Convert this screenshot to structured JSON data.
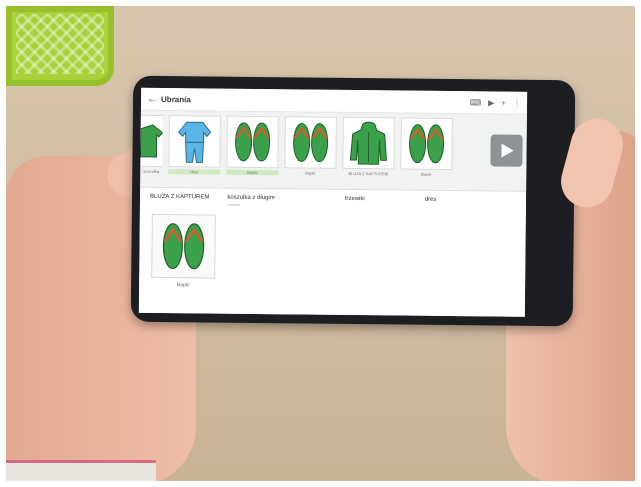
{
  "app": {
    "title": "Ubrania",
    "toolbar_icons": [
      "keyboard-icon",
      "play-icon",
      "plus-icon",
      "more-icon"
    ]
  },
  "strip": {
    "tiles": [
      {
        "label": "koszulka",
        "icon": "shirt-icon",
        "partial": true
      },
      {
        "label": "dres",
        "icon": "tracksuit-icon",
        "selected": true
      },
      {
        "label": "klapki",
        "icon": "flipflops-icon",
        "selected": true
      },
      {
        "label": "klapki",
        "icon": "flipflops-icon"
      },
      {
        "label": "BLUZA Z KAPTUREM",
        "icon": "hoodie-icon"
      },
      {
        "label": "klapki",
        "icon": "flipflops-icon"
      }
    ],
    "next_icon": "play-next-icon"
  },
  "sentence": {
    "words": [
      "BLUZA Z KAPTUREM",
      "koszulka z długim",
      "trzewiki",
      "dres"
    ],
    "subtext": "rękawem",
    "card": {
      "label": "klapki",
      "icon": "flipflops-icon"
    }
  },
  "colors": {
    "accent_green": "#3aa14a",
    "selected_bg": "#cfeac2",
    "tracksuit_blue": "#5ab4e6"
  }
}
